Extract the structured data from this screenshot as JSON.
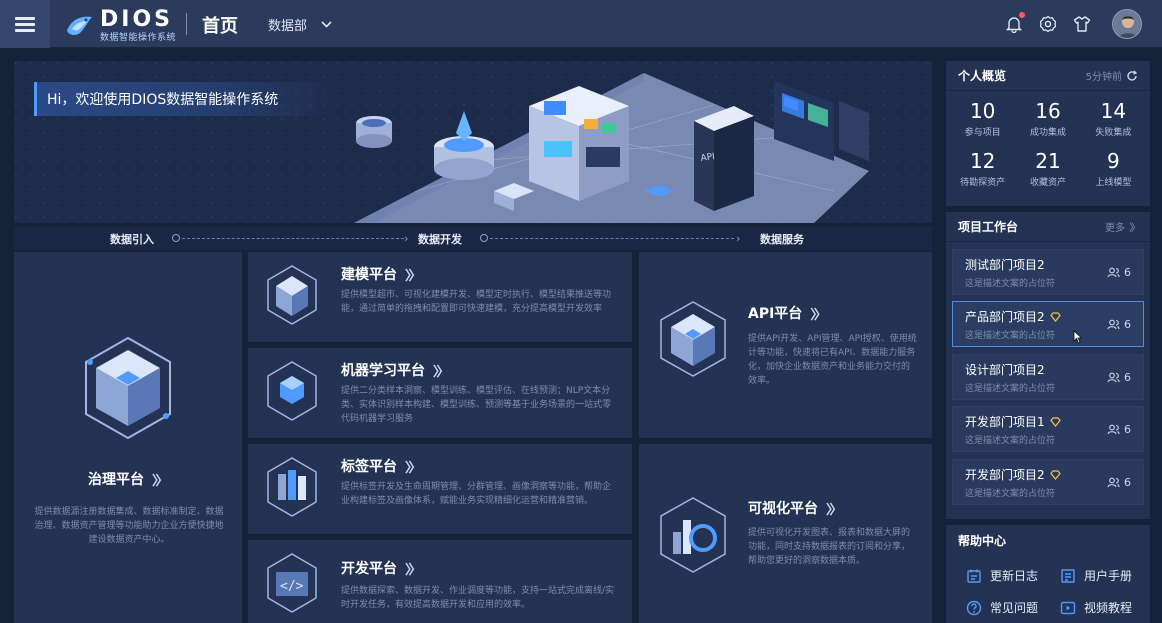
{
  "header": {
    "logo_text": "DIOS",
    "logo_sub": "数据智能操作系统",
    "page_title": "首页",
    "department": "数据部"
  },
  "hero": {
    "welcome": "Hi，欢迎使用DIOS数据智能操作系统"
  },
  "flow": {
    "steps": [
      "数据引入",
      "数据开发",
      "数据服务"
    ]
  },
  "platforms": {
    "governance": {
      "title": "治理平台",
      "desc": "提供数据源注册数据集成、数据标准制定、数据治理、数据资产管理等功能助力企业方便快捷地建设数据资产中心。"
    },
    "modeling": {
      "title": "建模平台",
      "desc": "提供模型超市、可视化建模开发、模型定时执行、模型结果推送等功能，通过简单的拖拽和配置即可快速建模，充分提高模型开发效率"
    },
    "ml": {
      "title": "机器学习平台",
      "desc": "提供二分类样本洞察、模型训练、模型评估、在线预测；NLP文本分类、实体识别样本构建、模型训练、预测等基于业务场景的一站式零代码机器学习服务"
    },
    "tag": {
      "title": "标签平台",
      "desc": "提供标签开发及生命周期管理、分群管理、画像洞察等功能，帮助企业构建标签及画像体系，赋能业务实现精细化运营和精准营销。"
    },
    "dev": {
      "title": "开发平台",
      "desc": "提供数据探索、数据开发、作业调度等功能，支持一站式完成离线/实时开发任务，有效提高数据开发和应用的效率。"
    },
    "api": {
      "title": "API平台",
      "desc": "提供API开发、API管理、API授权、使用统计等功能，快速将已有API、数据能力服务化，加快企业数据资产和业务能力交付的效率。"
    },
    "viz": {
      "title": "可视化平台",
      "desc": "提供可视化开发图表、报表和数据大屏的功能，同时支持数据报表的订阅和分享，帮助您更好的洞察数据本质。"
    }
  },
  "overview": {
    "title": "个人概览",
    "updated": "5分钟前",
    "stats": [
      {
        "value": "10",
        "label": "参与项目"
      },
      {
        "value": "16",
        "label": "成功集成"
      },
      {
        "value": "14",
        "label": "失败集成"
      },
      {
        "value": "12",
        "label": "待勘探资产"
      },
      {
        "value": "21",
        "label": "收藏资产"
      },
      {
        "value": "9",
        "label": "上线模型"
      }
    ]
  },
  "workbench": {
    "title": "项目工作台",
    "more": "更多",
    "projects": [
      {
        "name": "测试部门项目2",
        "desc": "这是描述文案的占位符",
        "members": "6"
      },
      {
        "name": "产品部门项目2",
        "desc": "这是描述文案的占位符",
        "members": "6"
      },
      {
        "name": "设计部门项目2",
        "desc": "这是描述文案的占位符",
        "members": "6"
      },
      {
        "name": "开发部门项目1",
        "desc": "这是描述文案的占位符",
        "members": "6"
      },
      {
        "name": "开发部门项目2",
        "desc": "这是描述文案的占位符",
        "members": "6"
      }
    ]
  },
  "help": {
    "title": "帮助中心",
    "items": [
      "更新日志",
      "用户手册",
      "常见问题",
      "视频教程"
    ]
  },
  "colors": {
    "bg": "#16213a",
    "card": "#243354",
    "accent": "#4e9cff",
    "badge": "#f5c542"
  }
}
